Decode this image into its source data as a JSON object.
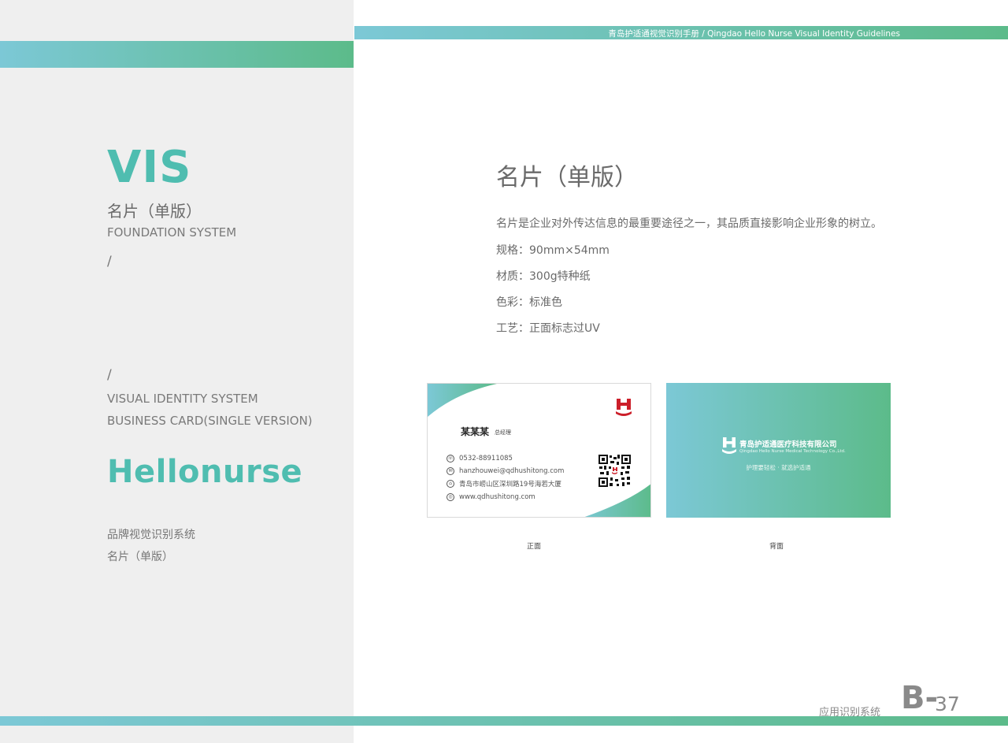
{
  "header": {
    "guideline_title": "青岛护适通视觉识别手册 / Qingdao Hello Nurse Visual Identity Guidelines"
  },
  "sidebar": {
    "vis": "VIS",
    "subtitle_cn": "名片（单版）",
    "foundation": "FOUNDATION SYSTEM",
    "slash": "/",
    "visual_identity": "VISUAL IDENTITY SYSTEM",
    "business_card": "BUSINESS CARD(SINGLE VERSION)",
    "brand_en": "Hellonurse",
    "brand_cn": "品牌视觉识别系统",
    "brand_cn2": "名片（单版）"
  },
  "main": {
    "title": "名片（单版）",
    "description": "名片是企业对外传达信息的最重要途径之一，其品质直接影响企业形象的树立。",
    "spec_size": "规格：90mm×54mm",
    "spec_material": "材质：300g特种纸",
    "spec_color": "色彩：标准色",
    "spec_craft": "工艺：正面标志过UV"
  },
  "card_front": {
    "name": "某某某",
    "role": "总经理",
    "phone": "0532-88911085",
    "email": "hanzhouwei@qdhushitong.com",
    "address": "青岛市崂山区深圳路19号海若大厦",
    "website": "www.qdhushitong.com",
    "caption": "正面"
  },
  "card_back": {
    "company_cn": "青岛护适通医疗科技有限公司",
    "company_en": "Qingdao Hello Nurse Medical Technology Co.,Ltd.",
    "slogan": "护理要轻松 · 就选护适通",
    "caption": "背面"
  },
  "footer": {
    "section_cn": "应用识别系统",
    "section_letter": "B-",
    "page_number": "37"
  },
  "colors": {
    "teal": "#4fbdb0",
    "gradient_start": "#7cc8d6",
    "gradient_end": "#5cbb8a",
    "logo_red": "#cc1f2a"
  }
}
